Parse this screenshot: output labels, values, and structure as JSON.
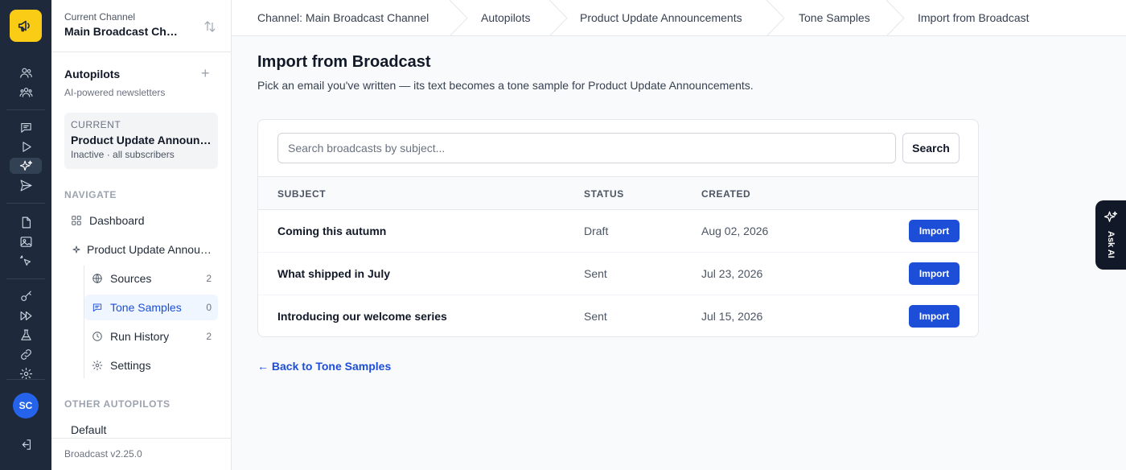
{
  "rail": {
    "avatar_initials": "SC",
    "icons": [
      "megaphone-icon",
      "users-icon",
      "users-group-icon",
      "message-icon",
      "play-icon",
      "sparkles-icon",
      "send-icon",
      "document-icon",
      "image-icon",
      "pointer-icon",
      "key-icon",
      "fast-forward-icon",
      "flask-icon",
      "link-icon",
      "gear-icon",
      "logout-icon"
    ]
  },
  "sidebar": {
    "channel_label": "Current Channel",
    "channel_name": "Main Broadcast Channel",
    "autopilots_title": "Autopilots",
    "autopilots_subtitle": "AI-powered newsletters",
    "current": {
      "label": "CURRENT",
      "title": "Product Update Announcements",
      "status": "Inactive · all subscribers"
    },
    "navigate_label": "NAVIGATE",
    "nav": {
      "dashboard": "Dashboard",
      "autopilot": "Product Update Announcements",
      "sources": "Sources",
      "sources_count": "2",
      "tone_samples": "Tone Samples",
      "tone_samples_count": "0",
      "run_history": "Run History",
      "run_history_count": "2",
      "settings": "Settings"
    },
    "other_label": "OTHER AUTOPILOTS",
    "other": {
      "default": "Default"
    },
    "version": "Broadcast v2.25.0"
  },
  "breadcrumb": {
    "items": [
      "Channel: Main Broadcast Channel",
      "Autopilots",
      "Product Update Announcements",
      "Tone Samples",
      "Import from Broadcast"
    ]
  },
  "main": {
    "title": "Import from Broadcast",
    "subtitle": "Pick an email you've written — its text becomes a tone sample for Product Update Announcements.",
    "search_placeholder": "Search broadcasts by subject...",
    "search_button": "Search",
    "columns": {
      "subject": "SUBJECT",
      "status": "STATUS",
      "created": "CREATED"
    },
    "rows": [
      {
        "subject": "Coming this autumn",
        "status": "Draft",
        "created": "Aug 02, 2026",
        "action": "Import"
      },
      {
        "subject": "What shipped in July",
        "status": "Sent",
        "created": "Jul 23, 2026",
        "action": "Import"
      },
      {
        "subject": "Introducing our welcome series",
        "status": "Sent",
        "created": "Jul 15, 2026",
        "action": "Import"
      }
    ],
    "back_link": "← Back to Tone Samples"
  },
  "ask_ai": {
    "label": "Ask AI"
  },
  "colors": {
    "accent": "#1d4ed8",
    "rail_bg": "#1e293b",
    "logo_bg": "#facc15"
  }
}
